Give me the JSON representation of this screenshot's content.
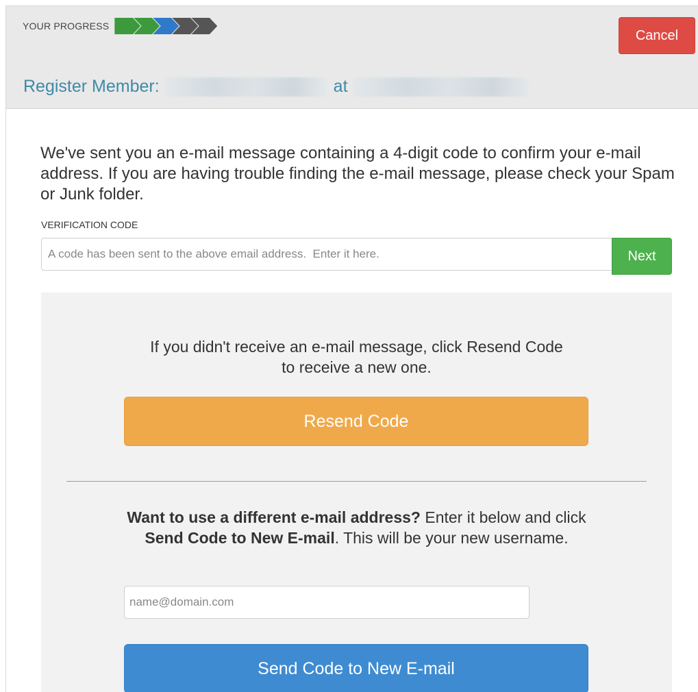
{
  "progress": {
    "label": "YOUR PROGRESS",
    "steps": [
      {
        "state": "done",
        "color": "#3c9a3c"
      },
      {
        "state": "done",
        "color": "#3c9a3c"
      },
      {
        "state": "current",
        "color": "#2f79c9"
      },
      {
        "state": "todo",
        "color": "#555555"
      },
      {
        "state": "todo",
        "color": "#555555"
      }
    ]
  },
  "header": {
    "cancel_label": "Cancel",
    "register_prefix": "Register Member:",
    "register_at": "at"
  },
  "intro": "We've sent you an e-mail message containing a 4-digit code to confirm your e-mail address. If you are having trouble finding the e-mail message, please check your Spam or Junk folder.",
  "verification": {
    "label": "VERIFICATION CODE",
    "placeholder": "A code has been sent to the above email address.  Enter it here.",
    "value": "",
    "next_label": "Next"
  },
  "resend": {
    "text_line1": "If you didn't receive an e-mail message, click Resend Code",
    "text_line2": "to receive a new one.",
    "button_label": "Resend Code"
  },
  "new_email": {
    "bold_question": "Want to use a different e-mail address?",
    "text_mid": " Enter it below and click ",
    "bold_action": "Send Code to New E-mail",
    "text_end": ". This will be your new username.",
    "placeholder": "name@domain.com",
    "value": "",
    "button_label": "Send Code to New E-mail"
  },
  "colors": {
    "cancel": "#de4b45",
    "next": "#4db14d",
    "resend": "#f0a94a",
    "send_new": "#3e8bd2",
    "title": "#3f8aa8"
  }
}
